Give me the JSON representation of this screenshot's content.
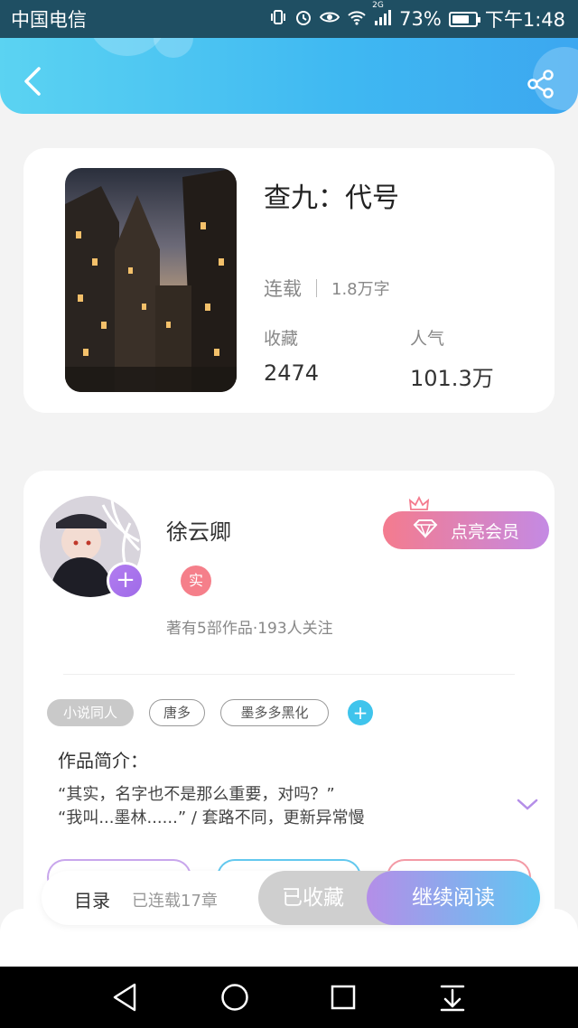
{
  "status_bar": {
    "carrier": "中国电信",
    "network": "2G",
    "battery_percent": "73%",
    "battery_level": 0.73,
    "time": "下午1:48"
  },
  "header": {
    "back_icon": "chevron-left-icon",
    "share_icon": "share-icon"
  },
  "book": {
    "title": "查九：代号",
    "status": "连载",
    "word_count": "1.8万字",
    "favorites_label": "收藏",
    "favorites_value": "2474",
    "popularity_label": "人气",
    "popularity_value": "101.3万"
  },
  "author": {
    "name": "徐云卿",
    "real_badge": "实",
    "stats": "著有5部作品·193人关注",
    "vip_button": "点亮会员",
    "follow_icon": "plus-icon"
  },
  "tags": [
    "小说同人",
    "唐多",
    "墨多多黑化"
  ],
  "intro": {
    "label": "作品简介：",
    "line1": "“其实，名字也不是那么重要，对吗？”",
    "line2": "“我叫...墨林......” / 套路不同，更新异常慢"
  },
  "action_bar": {
    "toc_label": "目录",
    "toc_count": "已连载17章",
    "collected_button": "已收藏",
    "read_button": "继续阅读"
  },
  "colors": {
    "header_start": "#5bd3f2",
    "header_end": "#3ca7f0",
    "vip_start": "#f47b8e",
    "vip_end": "#c48ae4",
    "read_start": "#b48ee8",
    "read_end": "#5fc7f2",
    "collected_bg": "#cfcfcf"
  }
}
